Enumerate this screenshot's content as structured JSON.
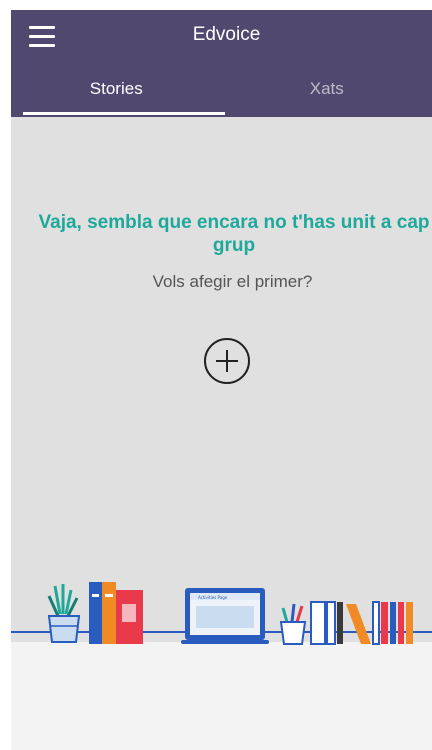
{
  "appbar": {
    "title": "Edvoice",
    "menu_icon": "hamburger-menu-icon",
    "background": "#514870"
  },
  "tabs": [
    {
      "label": "Stories",
      "active": true
    },
    {
      "label": "Xats",
      "active": false
    }
  ],
  "empty_state": {
    "title": "Vaja, sembla que encara no t'has unit a cap grup",
    "subtitle": "Vols afegir el primer?",
    "add_icon": "plus-circle-icon",
    "accent": "#1fa99a"
  },
  "illustration": {
    "laptop_screen_text": "Activities Page"
  }
}
